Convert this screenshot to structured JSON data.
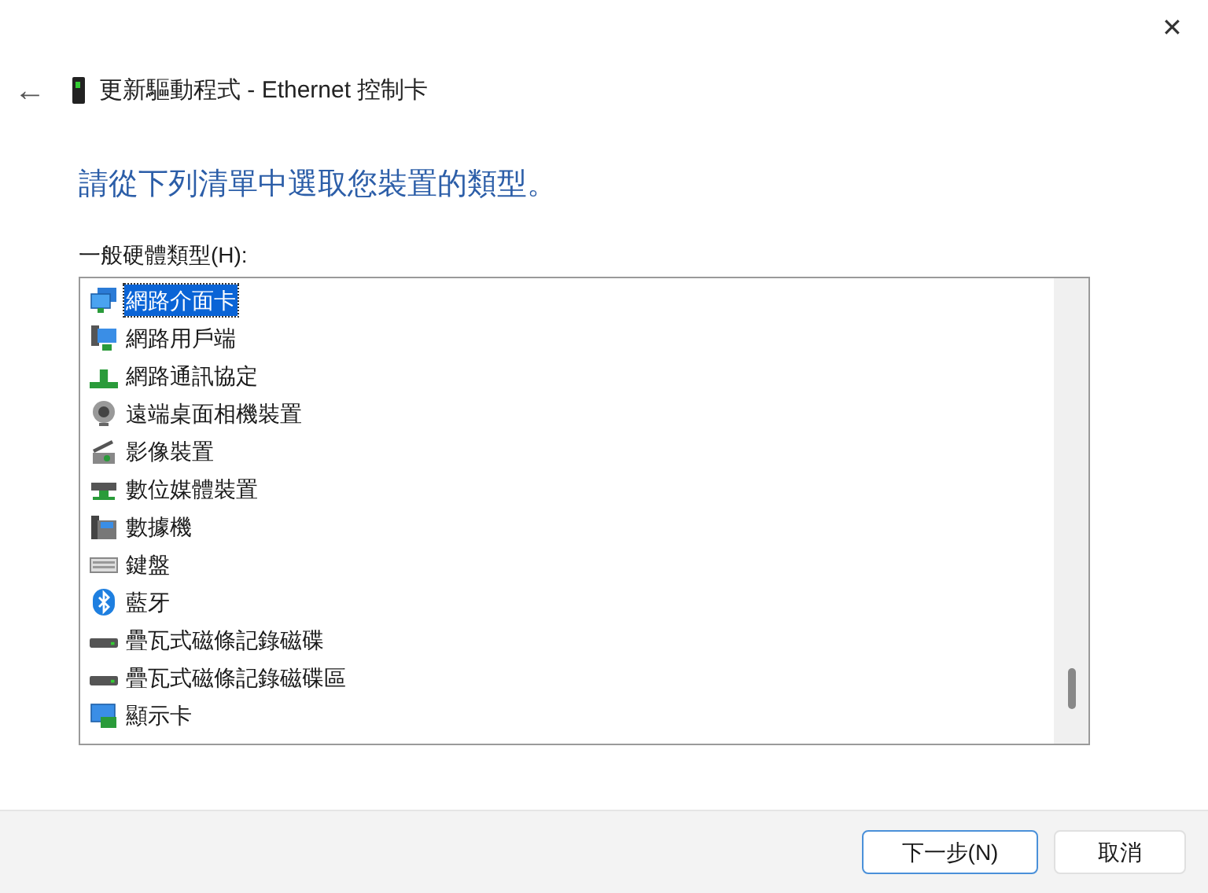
{
  "window": {
    "close": "✕",
    "back": "←",
    "title": "更新驅動程式 - Ethernet 控制卡"
  },
  "heading": "請從下列清單中選取您裝置的類型。",
  "list_label": "一般硬體類型(H):",
  "items": [
    {
      "label": "網路介面卡",
      "kind": "network",
      "selected": true
    },
    {
      "label": "網路用戶端",
      "kind": "client",
      "selected": false
    },
    {
      "label": "網路通訊協定",
      "kind": "protocol",
      "selected": false
    },
    {
      "label": "遠端桌面相機裝置",
      "kind": "camera",
      "selected": false
    },
    {
      "label": "影像裝置",
      "kind": "scanner",
      "selected": false
    },
    {
      "label": "數位媒體裝置",
      "kind": "media",
      "selected": false
    },
    {
      "label": "數據機",
      "kind": "modem",
      "selected": false
    },
    {
      "label": "鍵盤",
      "kind": "keyboard",
      "selected": false
    },
    {
      "label": "藍牙",
      "kind": "bluetooth",
      "selected": false
    },
    {
      "label": "疊瓦式磁條記錄磁碟",
      "kind": "disk",
      "selected": false
    },
    {
      "label": "疊瓦式磁條記錄磁碟區",
      "kind": "disk",
      "selected": false
    },
    {
      "label": "顯示卡",
      "kind": "display",
      "selected": false
    }
  ],
  "buttons": [
    {
      "label": "下一步(N)",
      "kind": "default"
    },
    {
      "label": "取消",
      "kind": "normal"
    }
  ]
}
